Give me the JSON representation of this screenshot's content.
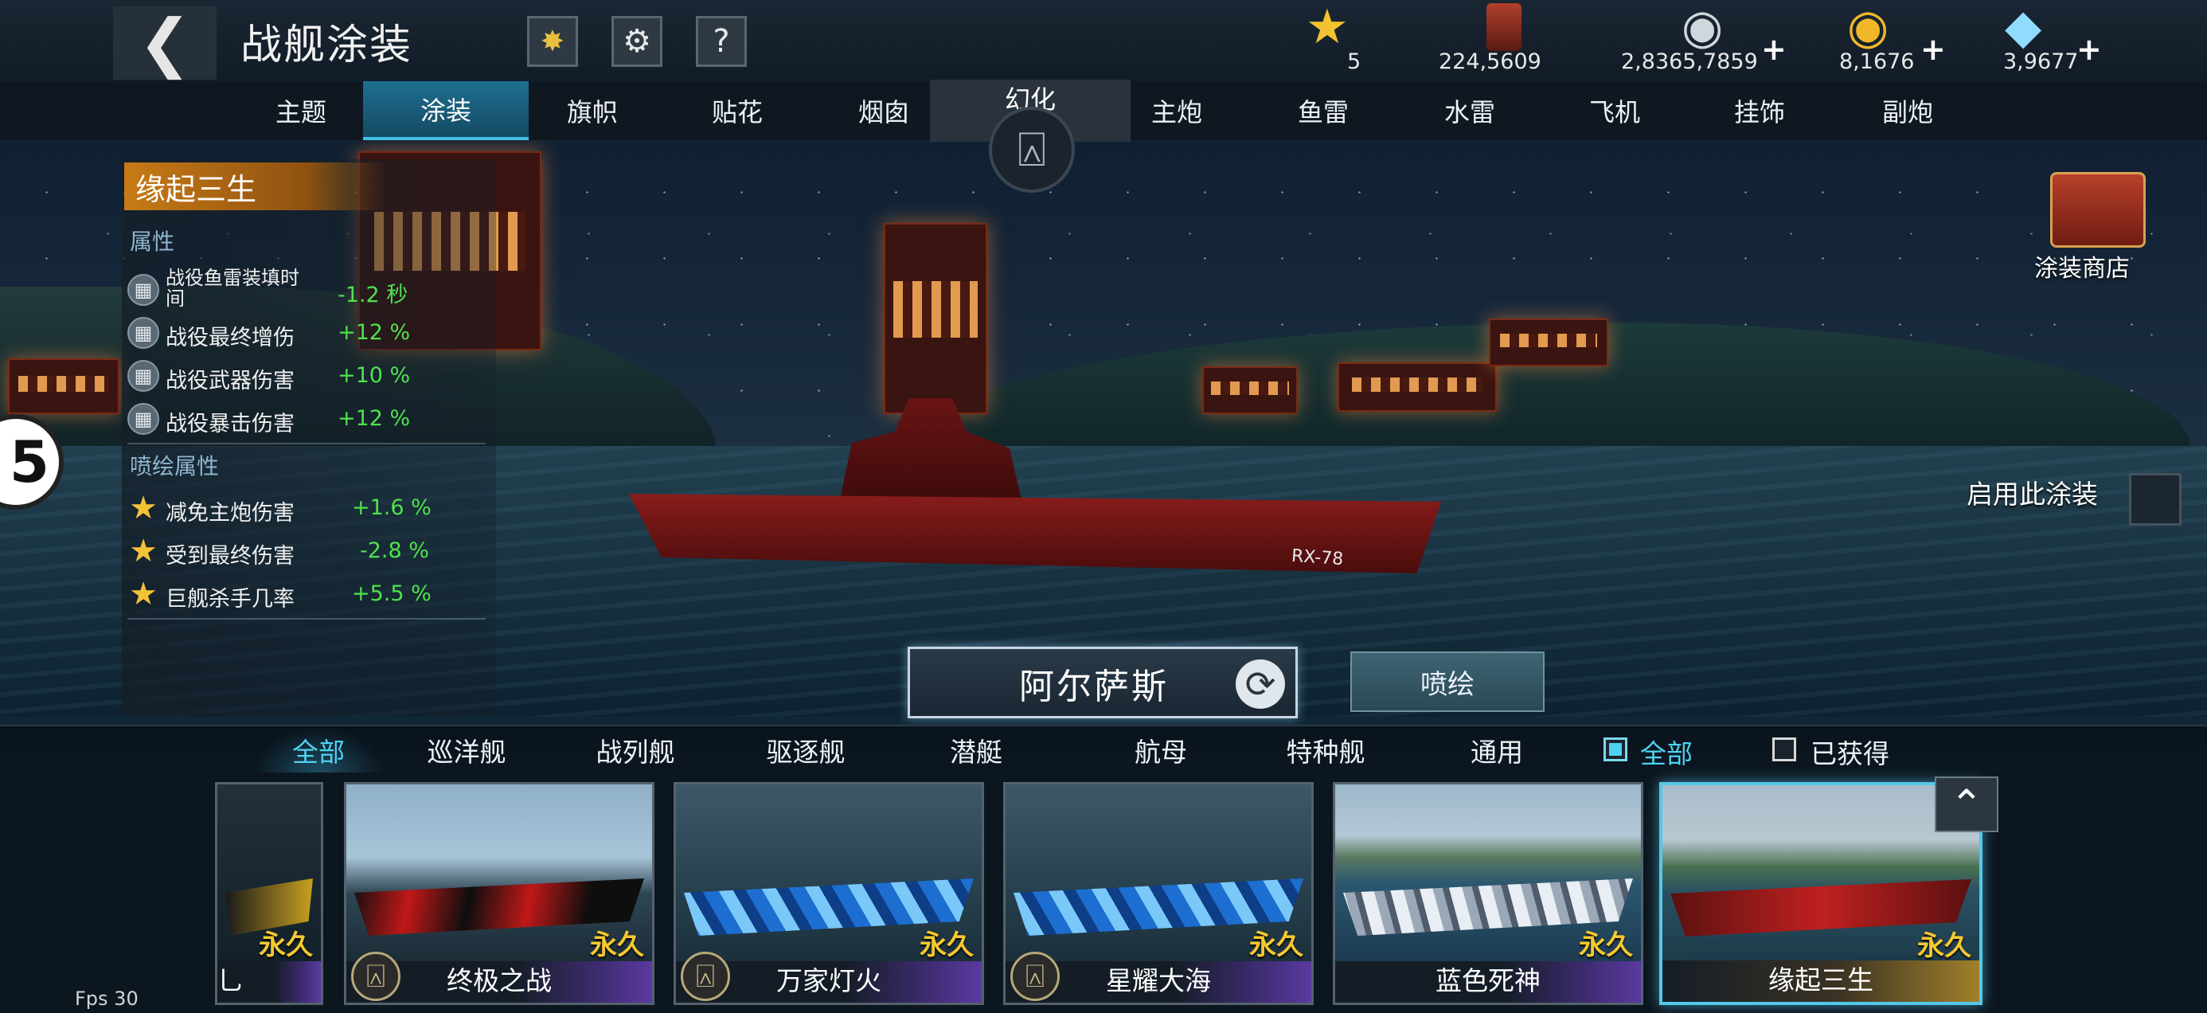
{
  "header": {
    "title": "战舰涂装",
    "fireworks_icon": "fireworks-icon",
    "settings_icon": "gear-icon",
    "help_label": "?"
  },
  "resources": [
    {
      "name": "star",
      "icon": "star-icon",
      "value": "5",
      "has_plus": false
    },
    {
      "name": "paint",
      "icon": "paint-bucket-icon",
      "value": "224,5609",
      "has_plus": false
    },
    {
      "name": "silver",
      "icon": "silver-coins-icon",
      "value": "2,8365,7859",
      "has_plus": true
    },
    {
      "name": "gold",
      "icon": "gold-coins-icon",
      "value": "8,1676",
      "has_plus": true
    },
    {
      "name": "diamond",
      "icon": "diamond-icon",
      "value": "3,9677",
      "has_plus": true
    }
  ],
  "tabs": [
    "主题",
    "涂装",
    "旗帜",
    "贴花",
    "烟囱",
    "主炮",
    "鱼雷",
    "水雷",
    "飞机",
    "挂饰",
    "副炮"
  ],
  "active_tab": "涂装",
  "magic_tab": {
    "label": "幻化"
  },
  "skin": {
    "name": "缘起三生",
    "attributes_title": "属性",
    "attributes": [
      {
        "name": "战役鱼雷装填时间",
        "value": "-1.2 秒"
      },
      {
        "name": "战役最终增伤",
        "value": "+12 %"
      },
      {
        "name": "战役武器伤害",
        "value": "+10 %"
      },
      {
        "name": "战役暴击伤害",
        "value": "+12 %"
      }
    ],
    "spray_title": "喷绘属性",
    "spray_attributes": [
      {
        "name": "减免主炮伤害",
        "value": "+1.6 %"
      },
      {
        "name": "受到最终伤害",
        "value": "-2.8 %"
      },
      {
        "name": "巨舰杀手几率",
        "value": "+5.5 %"
      }
    ]
  },
  "side_badge": "5",
  "shop": {
    "label": "涂装商店"
  },
  "enable_skin": {
    "label": "启用此涂装",
    "checked": false
  },
  "ship": {
    "name": "阿尔萨斯",
    "hull_label": "RX-78",
    "spray_button": "喷绘"
  },
  "filters": [
    "全部",
    "巡洋舰",
    "战列舰",
    "驱逐舰",
    "潜艇",
    "航母",
    "特种舰",
    "通用"
  ],
  "active_filter": "全部",
  "toggles": [
    {
      "label": "全部",
      "checked": true
    },
    {
      "label": "已获得",
      "checked": false
    }
  ],
  "cards": [
    {
      "name": "乚",
      "tag": "永久",
      "has_icon": false,
      "bar": "purple"
    },
    {
      "name": "终极之战",
      "tag": "永久",
      "has_icon": true,
      "bar": "purple"
    },
    {
      "name": "万家灯火",
      "tag": "永久",
      "has_icon": true,
      "bar": "purple"
    },
    {
      "name": "星耀大海",
      "tag": "永久",
      "has_icon": true,
      "bar": "purple"
    },
    {
      "name": "蓝色死神",
      "tag": "永久",
      "has_icon": false,
      "bar": "purple"
    },
    {
      "name": "缘起三生",
      "tag": "永久",
      "has_icon": false,
      "bar": "gold",
      "selected": true
    }
  ],
  "fps": "Fps 30",
  "colors": {
    "accent": "#4fd2f2",
    "positive": "#4ee24e",
    "gold": "#f4c830"
  }
}
